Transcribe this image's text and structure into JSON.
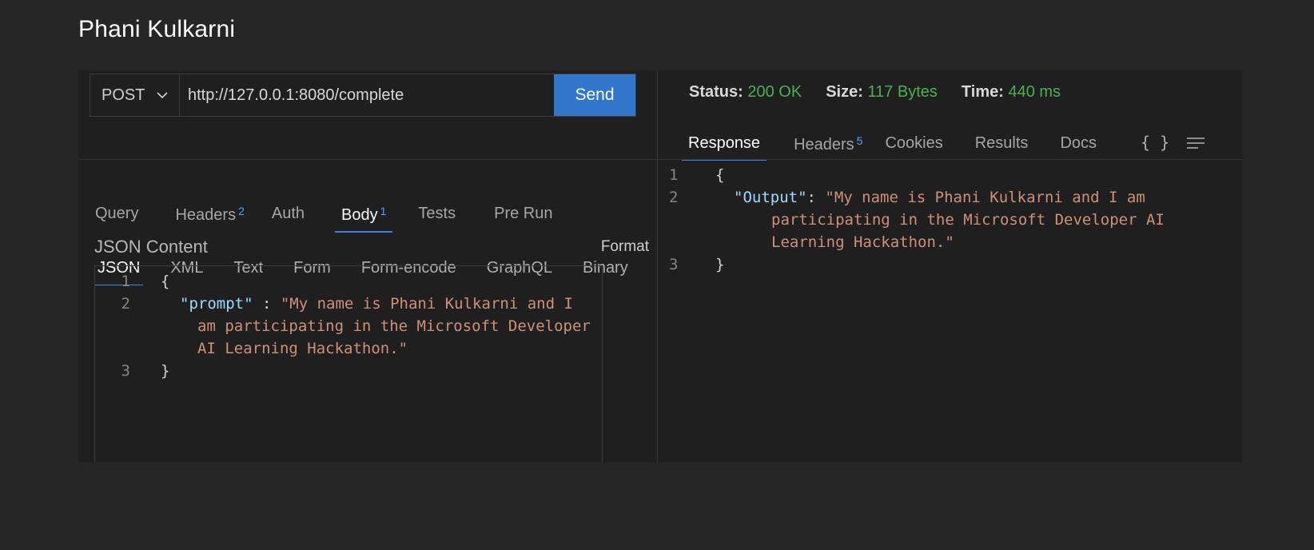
{
  "page": {
    "title": "Phani Kulkarni"
  },
  "request": {
    "method": "POST",
    "url": "http://127.0.0.1:8080/complete",
    "send_label": "Send",
    "tabs": [
      {
        "label": "Query",
        "badge": ""
      },
      {
        "label": "Headers",
        "badge": "2"
      },
      {
        "label": "Auth",
        "badge": ""
      },
      {
        "label": "Body",
        "badge": "1",
        "active": true
      },
      {
        "label": "Tests",
        "badge": ""
      },
      {
        "label": "Pre Run",
        "badge": ""
      }
    ],
    "body_tabs": [
      "JSON",
      "XML",
      "Text",
      "Form",
      "Form-encode",
      "GraphQL",
      "Binary"
    ],
    "body_active": "JSON",
    "json_label": "JSON Content",
    "format_label": "Format",
    "lines": {
      "n1": "1",
      "n2": "2",
      "n3": "3",
      "open": "{",
      "key": "\"prompt\"",
      "sep": " : ",
      "val1": "\"My name is Phani Kulkarni and I",
      "val2": "am participating in the Microsoft Developer",
      "val3": "AI Learning Hackathon.\"",
      "close": "}"
    }
  },
  "response": {
    "status_label": "Status:",
    "status_value": "200 OK",
    "size_label": "Size:",
    "size_value": "117 Bytes",
    "time_label": "Time:",
    "time_value": "440 ms",
    "tabs": [
      {
        "label": "Response",
        "badge": "",
        "active": true
      },
      {
        "label": "Headers",
        "badge": "5"
      },
      {
        "label": "Cookies",
        "badge": ""
      },
      {
        "label": "Results",
        "badge": ""
      },
      {
        "label": "Docs",
        "badge": ""
      }
    ],
    "braces_icon": "{ }",
    "lines": {
      "n1": "1",
      "n2": "2",
      "n3": "3",
      "open": "{",
      "key": "\"Output\"",
      "sep": ": ",
      "val1": "\"My name is Phani Kulkarni and I am",
      "val2": "participating in the Microsoft Developer AI",
      "val3": "Learning Hackathon.\"",
      "close": "}"
    }
  },
  "colors": {
    "accent": "#3377cc",
    "success": "#4caf50",
    "string": "#ce9178",
    "key": "#9cdcfe"
  }
}
